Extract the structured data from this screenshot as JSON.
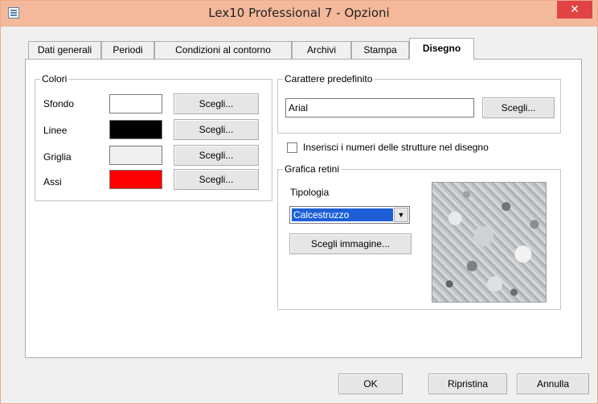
{
  "window": {
    "title": "Lex10 Professional 7 - Opzioni",
    "close_glyph": "✕",
    "title_bar_color": "#f4b89a",
    "close_color": "#e04343"
  },
  "tabs": [
    {
      "label": "Dati generali",
      "active": false
    },
    {
      "label": "Periodi",
      "active": false
    },
    {
      "label": "Condizioni al contorno",
      "active": false
    },
    {
      "label": "Archivi",
      "active": false
    },
    {
      "label": "Stampa",
      "active": false
    },
    {
      "label": "Disegno",
      "active": true
    }
  ],
  "colori": {
    "title": "Colori",
    "rows": [
      {
        "label": "Sfondo",
        "color": "#ffffff",
        "button": "Scegli..."
      },
      {
        "label": "Linee",
        "color": "#000000",
        "button": "Scegli..."
      },
      {
        "label": "Griglia",
        "color": "#f0f0f0",
        "button": "Scegli..."
      },
      {
        "label": "Assi",
        "color": "#ff0000",
        "button": "Scegli..."
      }
    ]
  },
  "carattere": {
    "title": "Carattere predefinito",
    "font_value": "Arial",
    "button": "Scegli..."
  },
  "numeri_checkbox": {
    "label": "Inserisci i numeri delle strutture nel disegno",
    "checked": false
  },
  "grafica": {
    "title": "Grafica retini",
    "tipologia_label": "Tipologia",
    "selected": "Calcestruzzo",
    "arrow_glyph": "▼",
    "image_button": "Scegli immagine...",
    "preview_icon": "concrete-texture"
  },
  "footer": {
    "ok": "OK",
    "ripristina": "Ripristina",
    "annulla": "Annulla"
  }
}
